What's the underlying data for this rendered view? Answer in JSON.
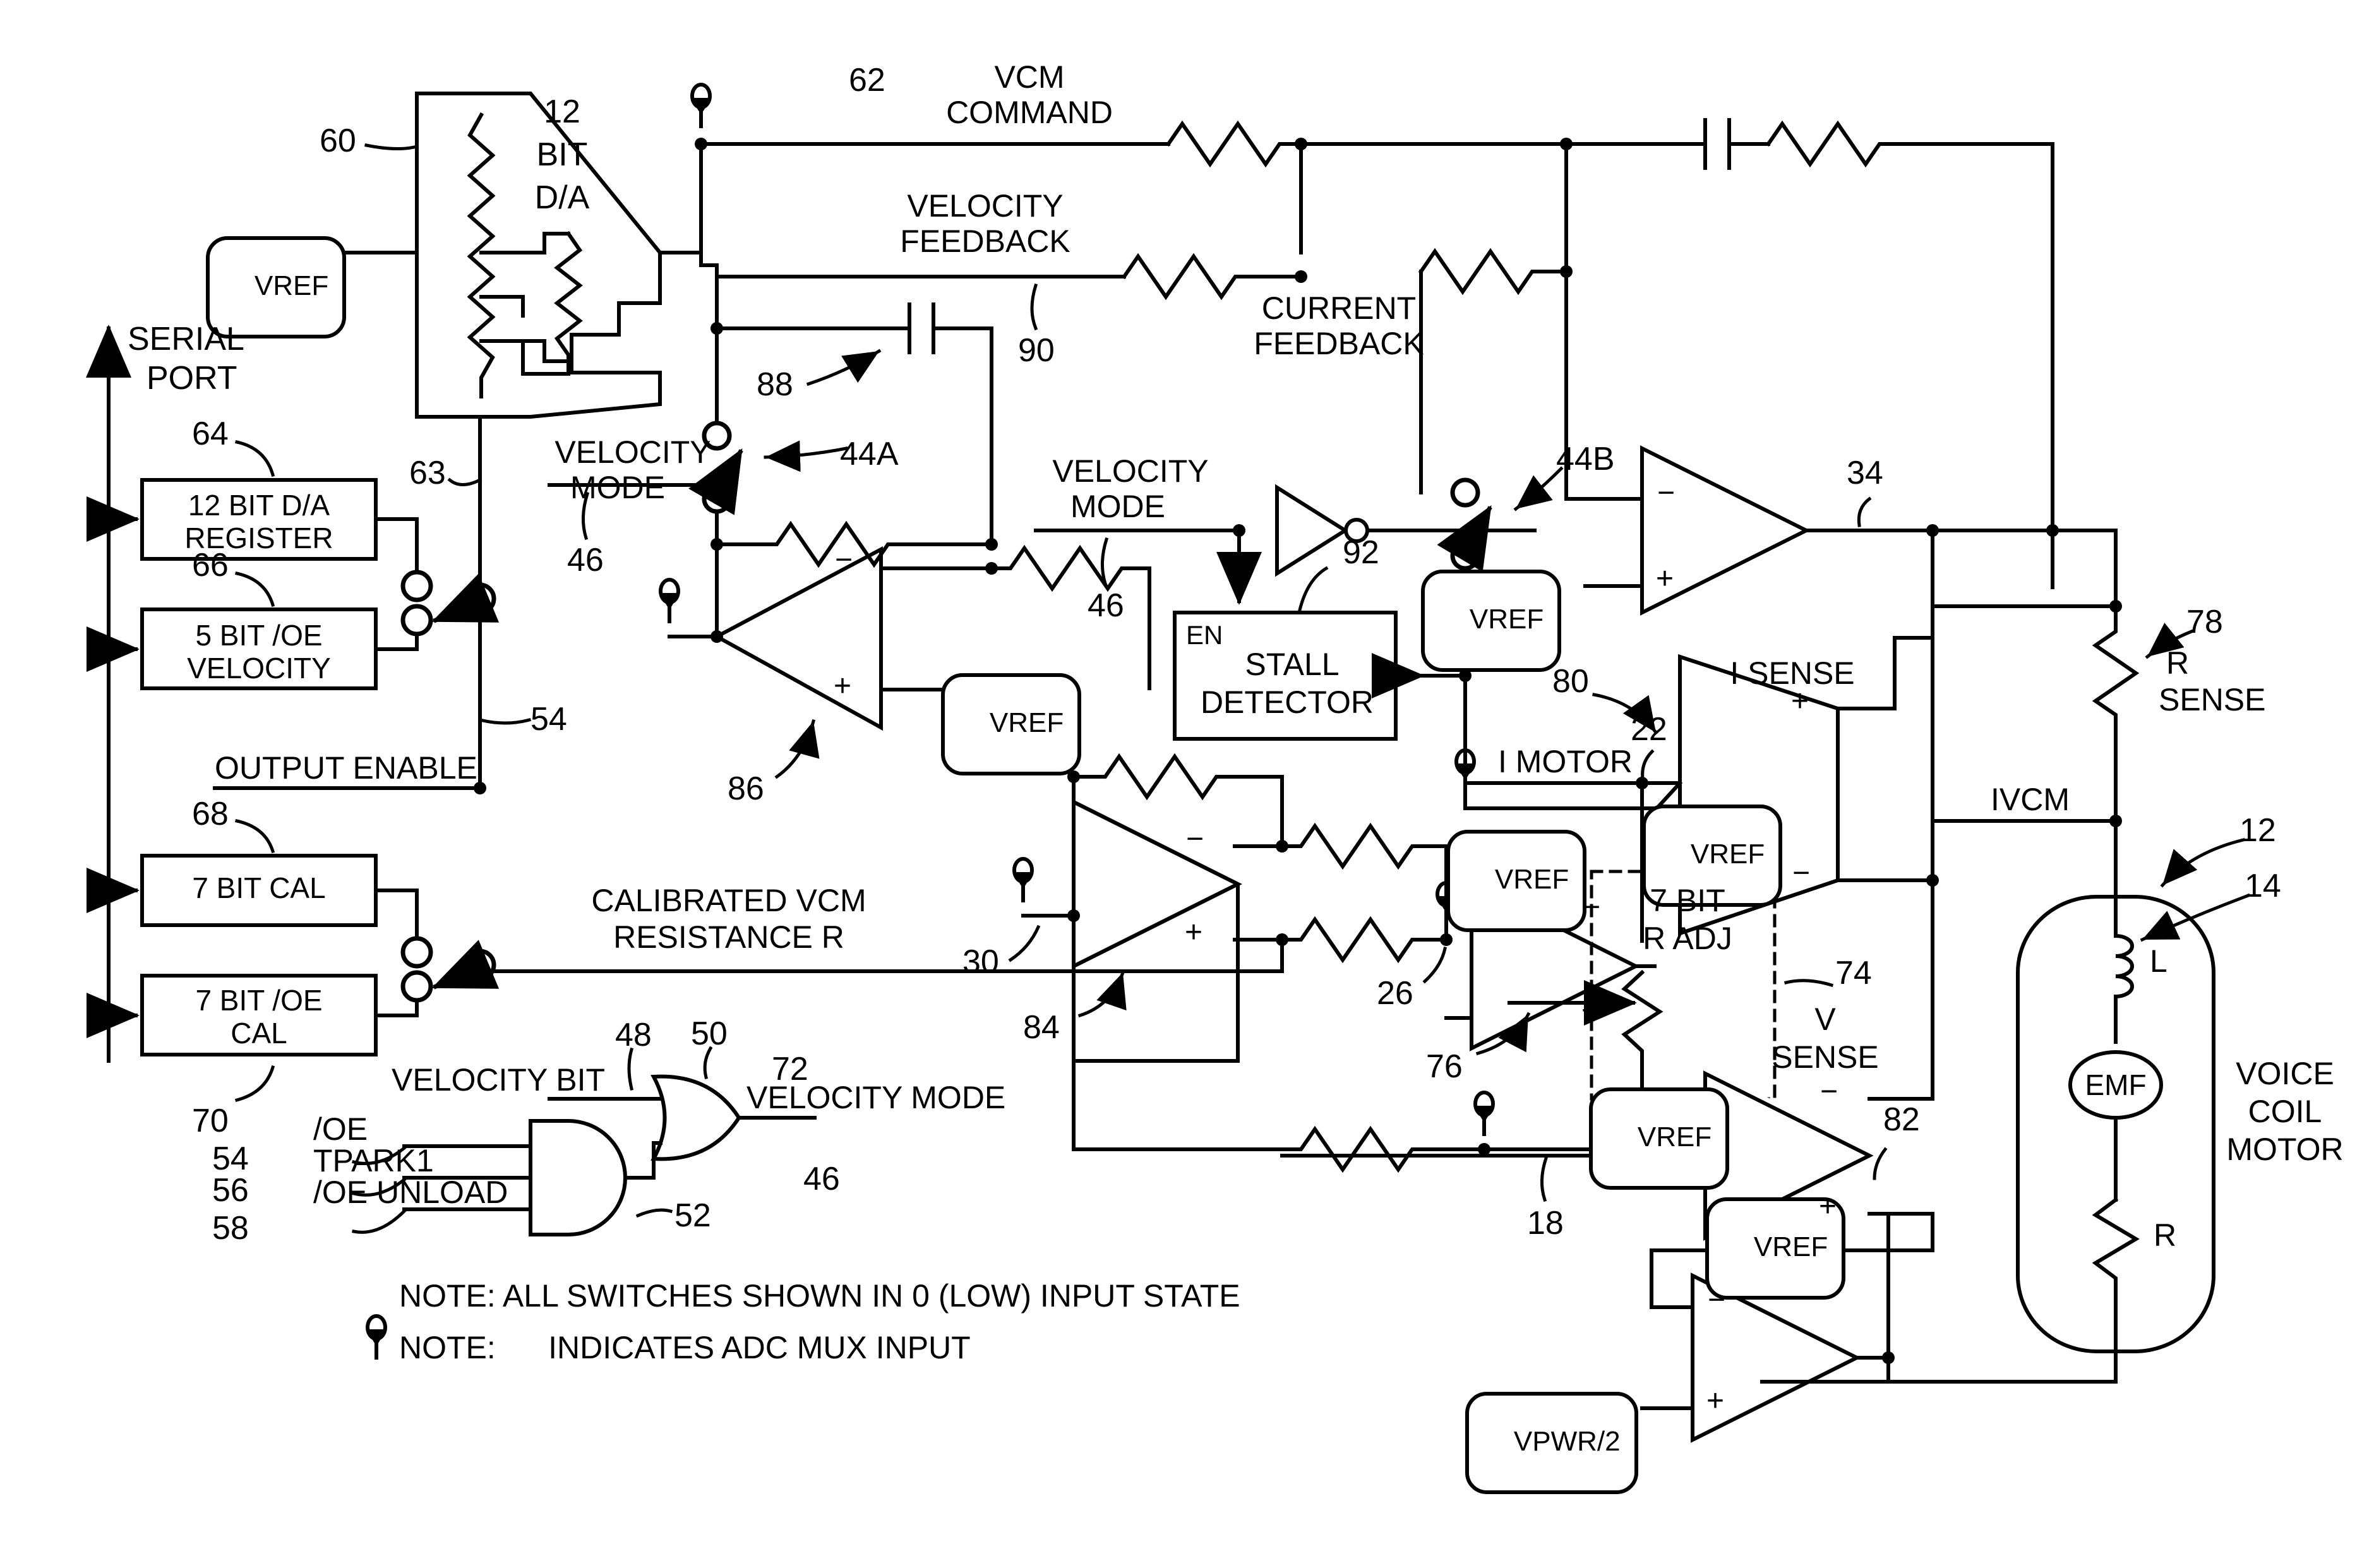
{
  "figure": {
    "type": "patent-circuit-schematic",
    "title_absent": true,
    "description": "Voice coil motor (VCM) driver schematic with serial-port-loaded registers, 12-bit D/A, velocity-mode switching, stall detector, current/voltage sense amplifiers and calibrated VCM resistance path."
  },
  "blocks": {
    "dac": {
      "label_line1": "12",
      "label_line2": "BIT",
      "label_line3": "D/A",
      "ref": "60"
    },
    "dac_reg": {
      "line1": "12 BIT D/A",
      "line2": "REGISTER",
      "ref": "64"
    },
    "oe_velocity_reg": {
      "line1": "5 BIT /OE",
      "line2": "VELOCITY",
      "ref": "66"
    },
    "cal_reg": {
      "line1": "7 BIT CAL",
      "line2": "",
      "ref": "68"
    },
    "oe_cal_reg": {
      "line1": "7 BIT /OE",
      "line2": "CAL",
      "ref": "70"
    },
    "stall_detector": {
      "en": "EN",
      "line1": "STALL",
      "line2": "DETECTOR",
      "ref": "92"
    },
    "r_adj": {
      "line1": "7 BIT",
      "line2": "R ADJ",
      "ref": "74"
    },
    "voice_coil_motor": {
      "line1": "VOICE",
      "line2": "COIL",
      "line3": "MOTOR",
      "ref_motor": "12",
      "ref_inductor": "14",
      "inductor_label": "L",
      "emf_label": "EMF",
      "resistor_label": "R"
    }
  },
  "nets": {
    "serial_port": {
      "line1": "SERIAL",
      "line2": "PORT"
    },
    "vcm_command": {
      "line1": "VCM",
      "line2": "COMMAND",
      "ref": "62"
    },
    "velocity_feedback": {
      "line1": "VELOCITY",
      "line2": "FEEDBACK",
      "ref": "90"
    },
    "current_feedback": {
      "line1": "CURRENT",
      "line2": "FEEDBACK"
    },
    "output_enable": {
      "label": "OUTPUT ENABLE",
      "ref": "54"
    },
    "calibrated_vcm_resistance": {
      "line1": "CALIBRATED VCM",
      "line2": "RESISTANCE R",
      "ref": "72"
    },
    "velocity_mode_left": {
      "line1": "VELOCITY",
      "line2": "MODE",
      "ref": "46"
    },
    "velocity_mode_mid": {
      "line1": "VELOCITY",
      "line2": "MODE",
      "ref": "46"
    },
    "velocity_mode_out": {
      "label": "VELOCITY MODE",
      "ref": "46"
    },
    "velocity_bit": {
      "label": "VELOCITY BIT",
      "ref": "48"
    },
    "i_motor": {
      "label": "I MOTOR",
      "ref": "22"
    },
    "ivcm": {
      "label": "IVCM"
    },
    "r_sense": {
      "line1": "R",
      "line2": "SENSE",
      "ref": "78"
    },
    "dac_out_ref": "63"
  },
  "gates": {
    "or_gate": {
      "ref": "50"
    },
    "and_gate": {
      "ref": "52"
    },
    "inverter_ref": "92_feeds"
  },
  "gate_inputs": [
    {
      "label": "/OE",
      "ref": "54"
    },
    {
      "label": "TPARK1",
      "ref": "56"
    },
    {
      "label": "/OE UNLOAD",
      "ref": "58"
    }
  ],
  "opamps": [
    {
      "name": "velocity-integrator",
      "ref": "86",
      "plus_ref": "VREF"
    },
    {
      "name": "summing-amp",
      "ref": "84",
      "plus_ref": "VREF"
    },
    {
      "name": "r-adj-amp",
      "ref": "76",
      "plus_ref": "VREF"
    },
    {
      "name": "error-amp",
      "ref": "34",
      "plus_ref": "VREF"
    },
    {
      "name": "i-sense-amp",
      "ref": "80",
      "label": "I SENSE",
      "plus_ref": "VREF"
    },
    {
      "name": "v-sense-amp",
      "ref": "82",
      "label_line1": "V",
      "label_line2": "SENSE",
      "plus_ref": "VREF"
    },
    {
      "name": "power-driver",
      "ref": "",
      "plus_ref": "VPWR/2"
    }
  ],
  "node_refs": {
    "adc_mux_30": "30",
    "adc_mux_26": "26",
    "adc_mux_18": "18",
    "switch_44A": "44A",
    "switch_44B": "44B"
  },
  "supply_labels": {
    "vref": "VREF",
    "vpwr_half": "VPWR/2"
  },
  "notes": [
    "NOTE: ALL SWITCHES SHOWN IN 0 (LOW) INPUT STATE",
    "NOTE:      INDICATES ADC MUX INPUT"
  ],
  "note_icon": "adc-mux-probe-icon",
  "colors": {
    "ink": "#000000",
    "paper": "#ffffff"
  }
}
